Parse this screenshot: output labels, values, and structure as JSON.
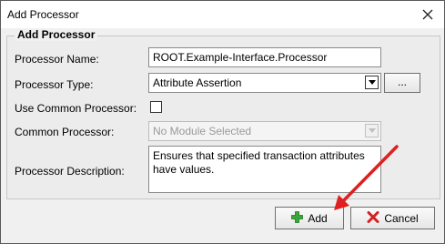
{
  "window": {
    "title": "Add Processor"
  },
  "group": {
    "title": "Add Processor"
  },
  "fields": {
    "name": {
      "label": "Processor Name:",
      "value": "ROOT.Example-Interface.Processor"
    },
    "type": {
      "label": "Processor Type:",
      "value": "Attribute Assertion",
      "browse_label": "..."
    },
    "use_common": {
      "label": "Use Common Processor:",
      "checked": false
    },
    "common": {
      "label": "Common Processor:",
      "value": "No Module Selected"
    },
    "description": {
      "label": "Processor Description:",
      "value": "Ensures that specified transaction attributes have values."
    }
  },
  "buttons": {
    "add_label": "Add",
    "cancel_label": "Cancel"
  },
  "colors": {
    "add_icon": "#3aa63a",
    "cancel_icon": "#d42020",
    "annotation_arrow": "#e02020"
  },
  "icons": {
    "close": "close-icon",
    "add": "plus-icon",
    "cancel": "cancel-x-icon"
  }
}
